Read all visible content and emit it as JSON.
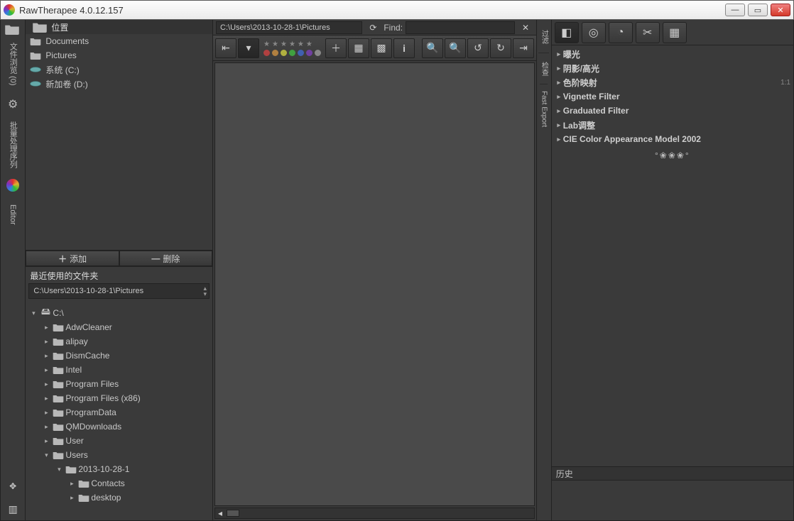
{
  "window": {
    "title": "RawTherapee 4.0.12.157"
  },
  "vtabs": {
    "browser": "文件浏览 (0)",
    "queue": "批量处理序列",
    "editor": "Editor"
  },
  "places": {
    "header": "位置",
    "items": [
      {
        "label": "Documents",
        "kind": "folder"
      },
      {
        "label": "Pictures",
        "kind": "folder"
      },
      {
        "label": "系统 (C:)",
        "kind": "volume"
      },
      {
        "label": "新加卷 (D:)",
        "kind": "volume"
      }
    ],
    "add": "添加",
    "remove": "删除"
  },
  "recent": {
    "header": "最近使用的文件夹",
    "value": "C:\\Users\\2013-10-28-1\\Pictures"
  },
  "tree": {
    "root": "C:\\",
    "nodes": [
      {
        "depth": 1,
        "label": "AdwCleaner"
      },
      {
        "depth": 1,
        "label": "alipay"
      },
      {
        "depth": 1,
        "label": "DismCache"
      },
      {
        "depth": 1,
        "label": "Intel"
      },
      {
        "depth": 1,
        "label": "Program Files"
      },
      {
        "depth": 1,
        "label": "Program Files (x86)"
      },
      {
        "depth": 1,
        "label": "ProgramData"
      },
      {
        "depth": 1,
        "label": "QMDownloads"
      },
      {
        "depth": 1,
        "label": "User"
      },
      {
        "depth": 1,
        "label": "Users",
        "expanded": true
      },
      {
        "depth": 2,
        "label": "2013-10-28-1",
        "expanded": true
      },
      {
        "depth": 3,
        "label": "Contacts"
      },
      {
        "depth": 3,
        "label": "desktop"
      }
    ]
  },
  "path": {
    "value": "C:\\Users\\2013-10-28-1\\Pictures",
    "find_label": "Find:",
    "find_value": ""
  },
  "color_dots": [
    "#b04040",
    "#b08040",
    "#b0b040",
    "#40a040",
    "#4060b0",
    "#7040a0",
    "#888888"
  ],
  "vtabs2": {
    "filter": "过滤",
    "inspect": "检查",
    "export": "Fast Export"
  },
  "right": {
    "sections": [
      {
        "label": "曝光"
      },
      {
        "label": "阴影/高光"
      },
      {
        "label": "色阶映射",
        "badge": "1:1"
      },
      {
        "label": "Vignette Filter"
      },
      {
        "label": "Graduated Filter"
      },
      {
        "label": "Lab调整"
      },
      {
        "label": "CIE Color Appearance Model 2002"
      }
    ],
    "history": "历史"
  }
}
